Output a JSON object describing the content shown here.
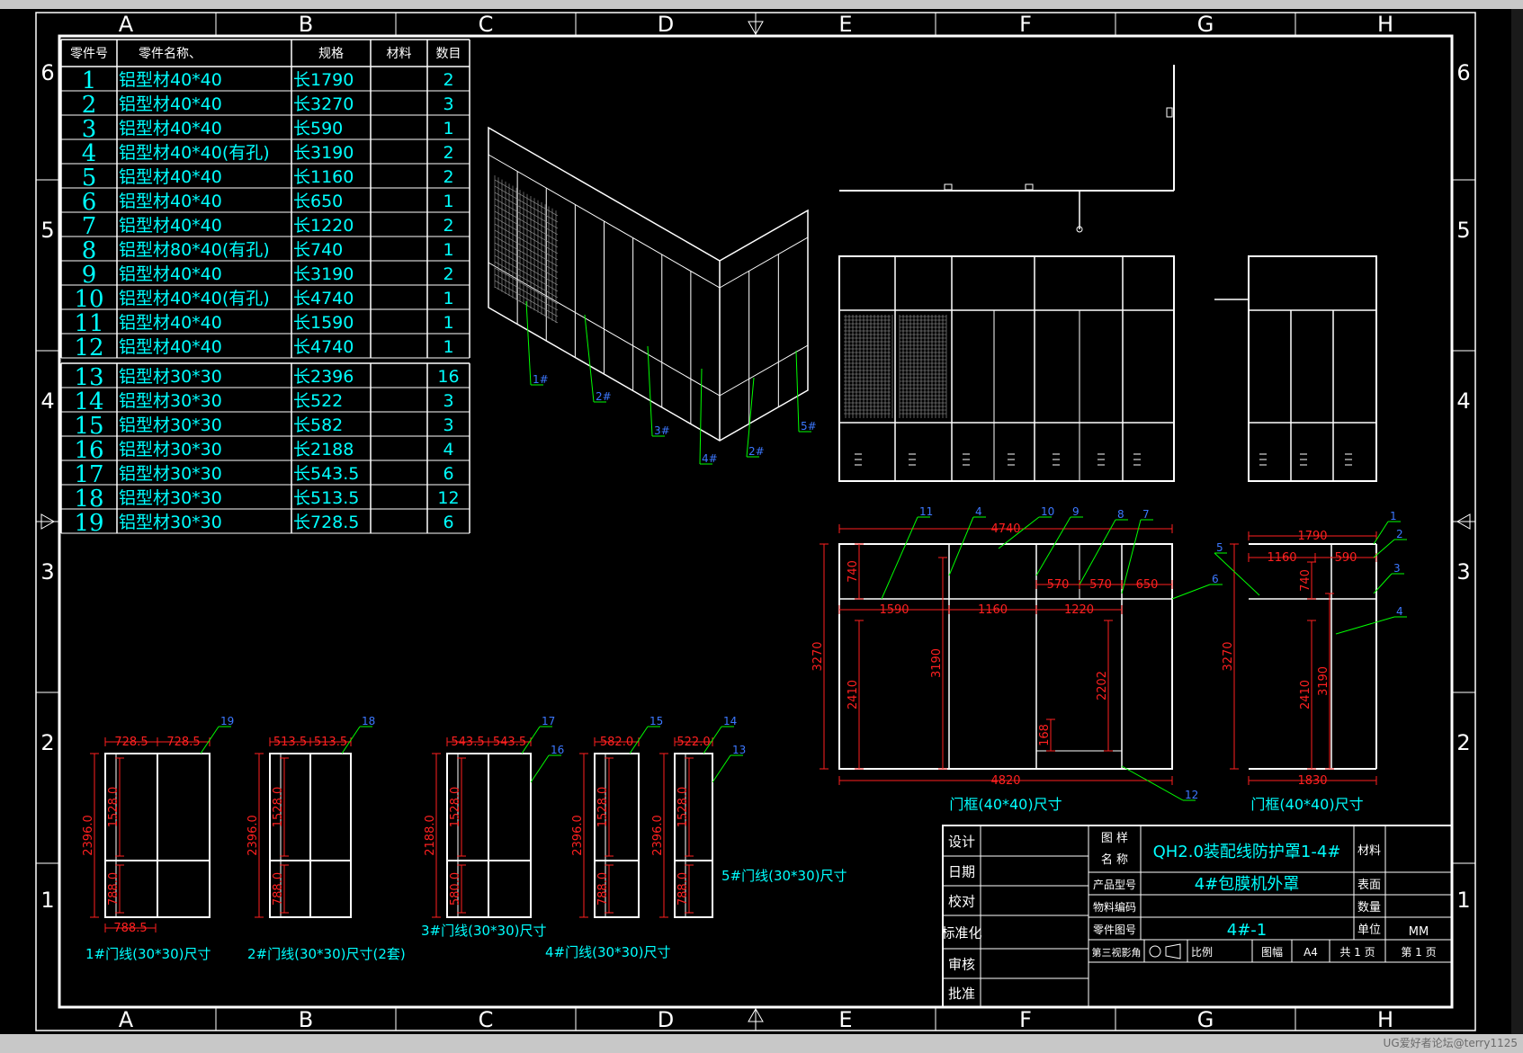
{
  "columns": [
    "A",
    "B",
    "C",
    "D",
    "E",
    "F",
    "G",
    "H"
  ],
  "rows": [
    "6",
    "5",
    "4",
    "3",
    "2",
    "1"
  ],
  "parts_table": {
    "headers": [
      "零件号",
      "零件名称、",
      "规格",
      "材料",
      "数目"
    ],
    "rows": [
      [
        "1",
        "铝型材40*40",
        "长1790",
        "",
        "2"
      ],
      [
        "2",
        "铝型材40*40",
        "长3270",
        "",
        "3"
      ],
      [
        "3",
        "铝型材40*40",
        "长590",
        "",
        "1"
      ],
      [
        "4",
        "铝型材40*40(有孔)",
        "长3190",
        "",
        "2"
      ],
      [
        "5",
        "铝型材40*40",
        "长1160",
        "",
        "2"
      ],
      [
        "6",
        "铝型材40*40",
        "长650",
        "",
        "1"
      ],
      [
        "7",
        "铝型材40*40",
        "长1220",
        "",
        "2"
      ],
      [
        "8",
        "铝型材80*40(有孔)",
        "长740",
        "",
        "1"
      ],
      [
        "9",
        "铝型材40*40",
        "长3190",
        "",
        "2"
      ],
      [
        "10",
        "铝型材40*40(有孔)",
        "长4740",
        "",
        "1"
      ],
      [
        "11",
        "铝型材40*40",
        "长1590",
        "",
        "1"
      ],
      [
        "12",
        "铝型材40*40",
        "长4740",
        "",
        "1"
      ],
      [
        "13",
        "铝型材30*30",
        "长2396",
        "",
        "16"
      ],
      [
        "14",
        "铝型材30*30",
        "长522",
        "",
        "3"
      ],
      [
        "15",
        "铝型材30*30",
        "长582",
        "",
        "3"
      ],
      [
        "16",
        "铝型材30*30",
        "长2188",
        "",
        "4"
      ],
      [
        "17",
        "铝型材30*30",
        "长543.5",
        "",
        "6"
      ],
      [
        "18",
        "铝型材30*30",
        "长513.5",
        "",
        "12"
      ],
      [
        "19",
        "铝型材30*30",
        "长728.5",
        "",
        "6"
      ]
    ]
  },
  "iso_labels": [
    "1#",
    "2#",
    "3#",
    "4#",
    "2#",
    "5#"
  ],
  "front_frame": {
    "caption": "门框(40*40)尺寸",
    "dims": {
      "top": "4740",
      "bottom": "4820",
      "h_total": "3270",
      "h_top": "740",
      "h_lower": "2410",
      "h_mid": "3190",
      "w1": "1590",
      "w2": "1160",
      "w3": "1220",
      "w4": "650",
      "w5": "570",
      "w6": "570",
      "h_door": "2202",
      "h_sill": "168"
    },
    "balloons": [
      "11",
      "4",
      "10",
      "9",
      "8",
      "7",
      "6",
      "12"
    ]
  },
  "side_frame": {
    "caption": "门框(40*40)尺寸",
    "dims": {
      "top": "1790",
      "sub_a": "1160",
      "sub_b": "590",
      "h_total": "3270",
      "h_top": "740",
      "h_lower": "2410",
      "h_mid": "3190",
      "bottom": "1830"
    },
    "balloons": [
      "1",
      "2",
      "3",
      "4",
      "5"
    ]
  },
  "door_frames": [
    {
      "caption": "1#门线(30*30)尺寸",
      "w1": "728.5",
      "w2": "728.5",
      "h": "2396.0",
      "h_up": "1528.0",
      "h_dn": "788.0",
      "bottom": "788.5",
      "balloon": "19"
    },
    {
      "caption": "2#门线(30*30)尺寸(2套)",
      "w1": "513.5",
      "w2": "513.5",
      "h": "2396.0",
      "h_up": "1528.0",
      "h_dn": "788.0",
      "balloon": "18"
    },
    {
      "caption": "3#门线(30*30)尺寸",
      "w1": "543.5",
      "w2": "543.5",
      "h": "2188.0",
      "h_up": "1528.0",
      "h_dn": "580.0",
      "balloon": "17",
      "balloon2": "16"
    },
    {
      "caption": "4#门线(30*30)尺寸",
      "w1": "582.0",
      "h": "2396.0",
      "h_up": "1528.0",
      "h_dn": "788.0",
      "balloon": "15"
    },
    {
      "caption": "5#门线(30*30)尺寸",
      "w1": "522.0",
      "h": "2396.0",
      "h_up": "1528.0",
      "h_dn": "788.0",
      "balloon": "14",
      "balloon2": "13"
    }
  ],
  "title_block": {
    "left_labels": [
      "设计",
      "日期",
      "校对",
      "标准化",
      "审核",
      "批准"
    ],
    "drawing_name_label": "图 样\n名 称",
    "drawing_name": "QH2.0装配线防护罩1-4#",
    "material_label": "材料",
    "product_model_label": "产品型号",
    "product_name": "4#包膜机外罩",
    "surface_label": "表面",
    "material_code_label": "物料编码",
    "quantity_label": "数量",
    "part_no_label": "零件图号",
    "part_no": "4#-1",
    "unit_label": "单位",
    "unit": "MM",
    "projection_label": "第三视影角",
    "scale_label": "比例",
    "size_label": "图幅",
    "size": "A4",
    "total_pages": "共 1 页",
    "page": "第 1 页"
  },
  "watermark": "UG爱好者论坛@terry1125",
  "colors": {
    "line": "#ffffff",
    "cyan": "#00ffff",
    "red": "#ff2020",
    "green": "#00ff00",
    "blue": "#3c78ff",
    "gray": "#a0a0a0"
  }
}
